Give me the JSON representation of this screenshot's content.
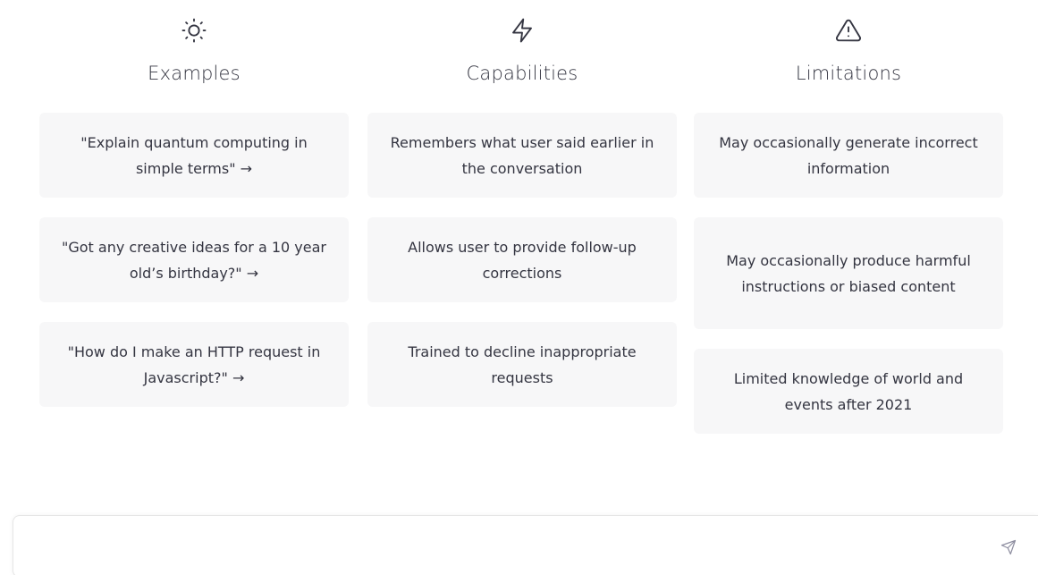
{
  "columns": [
    {
      "icon": "sun-icon",
      "title": "Examples",
      "cards": [
        "\"Explain quantum computing in simple terms\" →",
        "\"Got any creative ideas for a 10 year old’s birthday?\" →",
        "\"How do I make an HTTP request in Javascript?\" →"
      ]
    },
    {
      "icon": "lightning-icon",
      "title": "Capabilities",
      "cards": [
        "Remembers what user said earlier in the conversation",
        "Allows user to provide follow-up corrections",
        "Trained to decline inappropriate requests"
      ]
    },
    {
      "icon": "warning-triangle-icon",
      "title": "Limitations",
      "cards": [
        "May occasionally generate incorrect information",
        "May occasionally produce harmful instructions or biased content",
        "Limited knowledge of world and events after 2021"
      ]
    }
  ],
  "composer": {
    "value": "",
    "send_icon": "send-icon"
  },
  "colors": {
    "card_background": "#f7f7f8",
    "text": "#343541",
    "send_icon": "#8e8ea0"
  }
}
